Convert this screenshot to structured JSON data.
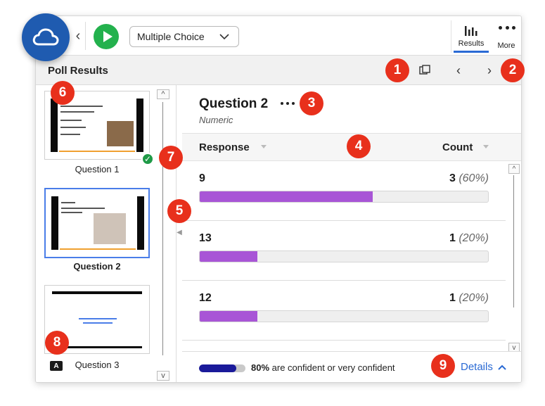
{
  "toolbar": {
    "question_type": "Multiple Choice",
    "results_label": "Results",
    "more_label": "More"
  },
  "header": {
    "title": "Poll Results"
  },
  "sidebar": {
    "items": [
      {
        "label": "Question 1",
        "answered": true,
        "selected": false
      },
      {
        "label": "Question 2",
        "answered": false,
        "selected": true
      },
      {
        "label": "Question 3",
        "answered": false,
        "selected": false,
        "badge": "A"
      }
    ]
  },
  "question": {
    "title": "Question 2",
    "subtitle": "Numeric"
  },
  "table": {
    "col_response": "Response",
    "col_count": "Count",
    "rows": [
      {
        "response": "9",
        "count": "3",
        "percent": "(60%)",
        "fraction": 0.6
      },
      {
        "response": "13",
        "count": "1",
        "percent": "(20%)",
        "fraction": 0.2
      },
      {
        "response": "12",
        "count": "1",
        "percent": "(20%)",
        "fraction": 0.2
      }
    ]
  },
  "footer": {
    "confidence_percent": "80%",
    "confidence_text": "are confident or very confident",
    "confidence_fraction": 0.8,
    "details_label": "Details"
  },
  "callouts": [
    "1",
    "2",
    "3",
    "4",
    "5",
    "6",
    "7",
    "8",
    "9"
  ],
  "colors": {
    "accent": "#2a6ad4",
    "bar": "#a855d6",
    "callout": "#e8301c",
    "play": "#23b14d",
    "check": "#1f9a47",
    "confidence": "#1a1a9a"
  }
}
